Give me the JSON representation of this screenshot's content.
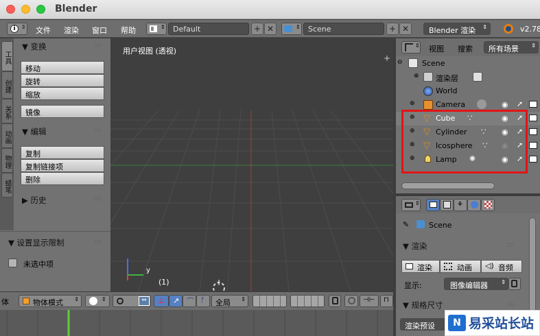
{
  "window": {
    "title": "Blender"
  },
  "menubar": {
    "menus": [
      "文件",
      "渲染",
      "窗口",
      "帮助"
    ],
    "layout_field": "Default",
    "scene_field": "Scene",
    "engine": "Blender 渲染",
    "version": "v2.78"
  },
  "toolshelf": {
    "tabs": [
      "工具",
      "创建",
      "关系",
      "动画",
      "物理",
      "蜡笔"
    ],
    "transform_panel": {
      "title": "变换",
      "buttons": [
        "移动",
        "旋转",
        "缩放",
        "镜像"
      ]
    },
    "edit_panel": {
      "title": "编辑",
      "buttons": [
        "复制",
        "复制链接项",
        "删除"
      ]
    },
    "history_panel": {
      "title": "历史"
    },
    "display_limit_panel": {
      "title": "设置显示限制",
      "checkbox_label": "未选中项"
    }
  },
  "viewport": {
    "label": "用户视图 (透视)",
    "frame": "(1)",
    "axis_y": "y"
  },
  "viewport_header": {
    "edge_label": "体",
    "mode": "物体模式",
    "orientation": "全局"
  },
  "outliner": {
    "view_label": "视图",
    "search_label": "搜索",
    "filter": "所有场景",
    "items": [
      {
        "label": "Scene",
        "icon": "scene-icon"
      },
      {
        "label": "渲染层",
        "icon": "render-layers-icon"
      },
      {
        "label": "World",
        "icon": "world-icon"
      },
      {
        "label": "Camera",
        "icon": "camera-icon"
      },
      {
        "label": "Cube",
        "icon": "mesh-icon"
      },
      {
        "label": "Cylinder",
        "icon": "mesh-icon"
      },
      {
        "label": "Icosphere",
        "icon": "mesh-icon"
      },
      {
        "label": "Lamp",
        "icon": "lamp-icon"
      }
    ]
  },
  "properties": {
    "scene_label": "Scene",
    "render_panel": {
      "title": "渲染",
      "buttons": [
        "渲染",
        "动画",
        "音频"
      ],
      "display_label": "显示:",
      "display_value": "图像编辑器"
    },
    "dimensions_panel": {
      "title": "规格尺寸"
    },
    "preset_label": "渲染预设"
  },
  "watermark": {
    "text": "易采站长站"
  },
  "colors": {
    "highlight": "#e21414",
    "selection_active": "#ffffff"
  }
}
